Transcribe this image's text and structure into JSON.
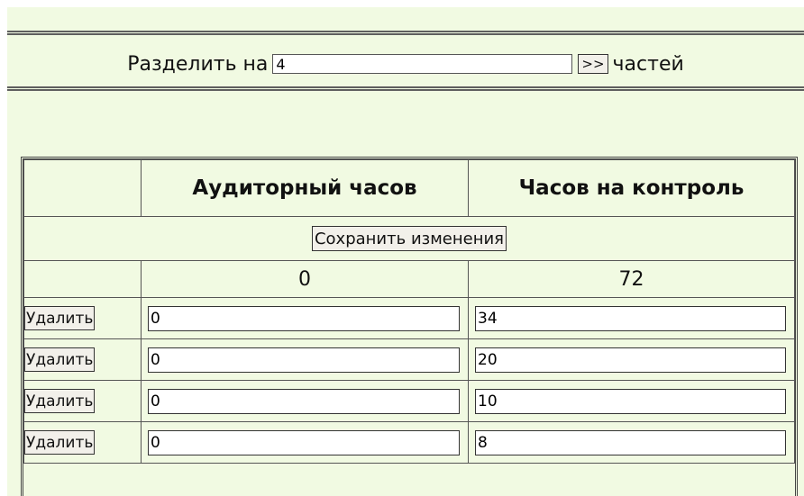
{
  "split": {
    "label_before": "Разделить на",
    "parts_value": "4",
    "go_button_label": ">>",
    "label_after": "частей"
  },
  "table": {
    "headers": [
      "",
      "Аудиторный часов",
      "Часов на контроль"
    ],
    "save_button_label": "Сохранить изменения",
    "totals": [
      "0",
      "72"
    ],
    "rows": [
      {
        "delete_label": "Удалить",
        "auditory": "0",
        "control": "34"
      },
      {
        "delete_label": "Удалить",
        "auditory": "0",
        "control": "20"
      },
      {
        "delete_label": "Удалить",
        "auditory": "0",
        "control": "10"
      },
      {
        "delete_label": "Удалить",
        "auditory": "0",
        "control": "8"
      }
    ]
  },
  "colors": {
    "background": "#f1fae2",
    "border": "#555555",
    "button_bg": "#f2f0ea"
  }
}
